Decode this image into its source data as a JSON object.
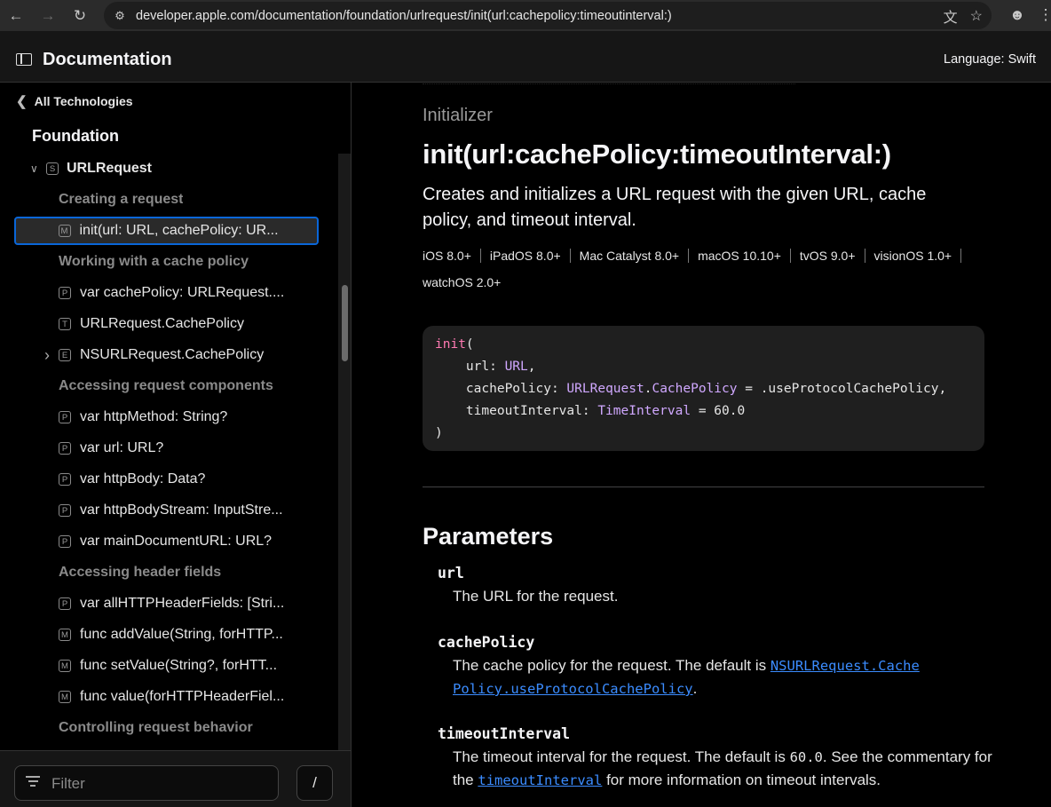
{
  "browser": {
    "url": "developer.apple.com/documentation/foundation/urlrequest/init(url:cachepolicy:timeoutinterval:)"
  },
  "header": {
    "title": "Documentation",
    "language_label": "Language: Swift"
  },
  "sidebar": {
    "back_label": "All Technologies",
    "framework": "Foundation",
    "items": [
      {
        "type": "symbol",
        "badge": "S",
        "label": "URLRequest",
        "disclosure": "expanded"
      },
      {
        "type": "heading",
        "label": "Creating a request"
      },
      {
        "type": "item",
        "badge": "M",
        "label": "init(url: URL, cachePolicy: UR...",
        "selected": true
      },
      {
        "type": "heading",
        "label": "Working with a cache policy"
      },
      {
        "type": "item",
        "badge": "P",
        "label": "var cachePolicy: URLRequest...."
      },
      {
        "type": "item",
        "badge": "T",
        "label": "URLRequest.CachePolicy"
      },
      {
        "type": "item",
        "badge": "E",
        "label": "NSURLRequest.CachePolicy",
        "disclosure": "collapsed"
      },
      {
        "type": "heading",
        "label": "Accessing request components"
      },
      {
        "type": "item",
        "badge": "P",
        "label": "var httpMethod: String?"
      },
      {
        "type": "item",
        "badge": "P",
        "label": "var url: URL?"
      },
      {
        "type": "item",
        "badge": "P",
        "label": "var httpBody: Data?"
      },
      {
        "type": "item",
        "badge": "P",
        "label": "var httpBodyStream: InputStre..."
      },
      {
        "type": "item",
        "badge": "P",
        "label": "var mainDocumentURL: URL?"
      },
      {
        "type": "heading",
        "label": "Accessing header fields"
      },
      {
        "type": "item",
        "badge": "P",
        "label": "var allHTTPHeaderFields: [Stri..."
      },
      {
        "type": "item",
        "badge": "M",
        "label": "func addValue(String, forHTTP..."
      },
      {
        "type": "item",
        "badge": "M",
        "label": "func setValue(String?, forHTT..."
      },
      {
        "type": "item",
        "badge": "M",
        "label": "func value(forHTTPHeaderFiel..."
      },
      {
        "type": "heading",
        "label": "Controlling request behavior"
      }
    ],
    "filter_placeholder": "Filter",
    "filter_shortcut": "/"
  },
  "main": {
    "kind": "Initializer",
    "symbol": "init(url:cachePolicy:timeoutInterval:)",
    "abstract": "Creates and initializes a URL request with the given URL, cache policy, and timeout interval.",
    "availability": [
      "iOS 8.0+",
      "iPadOS 8.0+",
      "Mac Catalyst 8.0+",
      "macOS 10.10+",
      "tvOS 9.0+",
      "visionOS 1.0+",
      "watchOS 2.0+"
    ],
    "declaration": {
      "keyword": "init",
      "open": "(",
      "url_label": "url: ",
      "url_type": "URL",
      "url_sep": ",",
      "cache_label": "cachePolicy: ",
      "cache_type_a": "URLRequest",
      "cache_dot": ".",
      "cache_type_b": "CachePolicy",
      "cache_default": " = .useProtocolCachePolicy,",
      "timeout_label": "timeoutInterval: ",
      "timeout_type": "TimeInterval",
      "timeout_default": " = 60.0",
      "close": ")"
    },
    "parameters_heading": "Parameters",
    "parameters": [
      {
        "name": "url",
        "desc": "The URL for the request."
      },
      {
        "name": "cachePolicy",
        "desc_prefix": "The cache policy for the request. The default is ",
        "link_line1": "NSURLRequest.Cache",
        "link_line2": "Policy.useProtocolCachePolicy",
        "desc_suffix": "."
      },
      {
        "name": "timeoutInterval",
        "desc_prefix": "The timeout interval for the request. The default is ",
        "code": "60.0",
        "desc_mid": ". See the commentary for the ",
        "link": "timeoutInterval",
        "desc_suffix": " for more information on timeout intervals."
      }
    ]
  }
}
